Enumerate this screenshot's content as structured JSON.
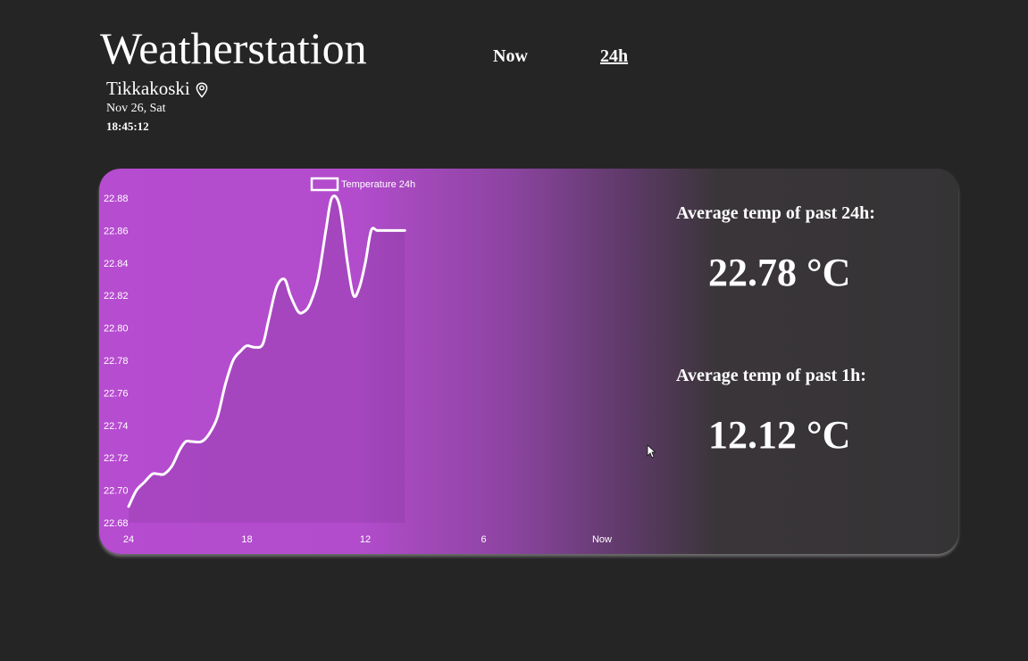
{
  "header": {
    "title": "Weatherstation",
    "location": "Tikkakoski",
    "date": "Nov 26, Sat",
    "time": "18:45:12"
  },
  "nav": {
    "now_label": "Now",
    "h24_label": "24h"
  },
  "stats": {
    "avg24_label": "Average temp of past 24h:",
    "avg24_value": "22.78 °C",
    "avg1_label": "Average temp of past 1h:",
    "avg1_value": "12.12 °C"
  },
  "colors": {
    "card_gradient_start": "#b64cd0",
    "card_gradient_end": "#353435",
    "line": "#ffffff",
    "background": "#262526"
  },
  "chart_data": {
    "type": "line",
    "legend": "Temperature 24h",
    "x_tick_labels": [
      "24",
      "18",
      "12",
      "6",
      "Now"
    ],
    "x_tick_hours_ago": [
      24,
      18,
      12,
      6,
      0
    ],
    "xlim": [
      24,
      0
    ],
    "ylim": [
      22.68,
      22.88
    ],
    "y_ticks": [
      "22.88",
      "22.86",
      "22.84",
      "22.82",
      "22.80",
      "22.78",
      "22.76",
      "22.74",
      "22.72",
      "22.70",
      "22.68"
    ],
    "series": [
      {
        "name": "Temperature 24h",
        "x_hours_ago": [
          24.0,
          23.6,
          23.2,
          22.8,
          22.5,
          22.2,
          21.8,
          21.4,
          21.1,
          20.8,
          20.3,
          19.9,
          19.5,
          19.1,
          18.7,
          18.3,
          18.0,
          17.6,
          17.2,
          16.9,
          16.5,
          16.1,
          15.8,
          15.4,
          15.1,
          14.8,
          14.4,
          14.0,
          13.7,
          13.3,
          12.9,
          12.6,
          12.3,
          12.0,
          11.7,
          11.4,
          11.0,
          10.7,
          10.4,
          10.0
        ],
        "values": [
          22.69,
          22.7,
          22.705,
          22.71,
          22.71,
          22.71,
          22.715,
          22.725,
          22.73,
          22.73,
          22.73,
          22.735,
          22.745,
          22.765,
          22.78,
          22.786,
          22.789,
          22.788,
          22.79,
          22.805,
          22.825,
          22.83,
          22.82,
          22.81,
          22.81,
          22.815,
          22.83,
          22.86,
          22.88,
          22.875,
          22.84,
          22.82,
          22.825,
          22.84,
          22.86,
          22.86,
          22.86,
          22.86,
          22.86,
          22.86
        ]
      }
    ]
  }
}
